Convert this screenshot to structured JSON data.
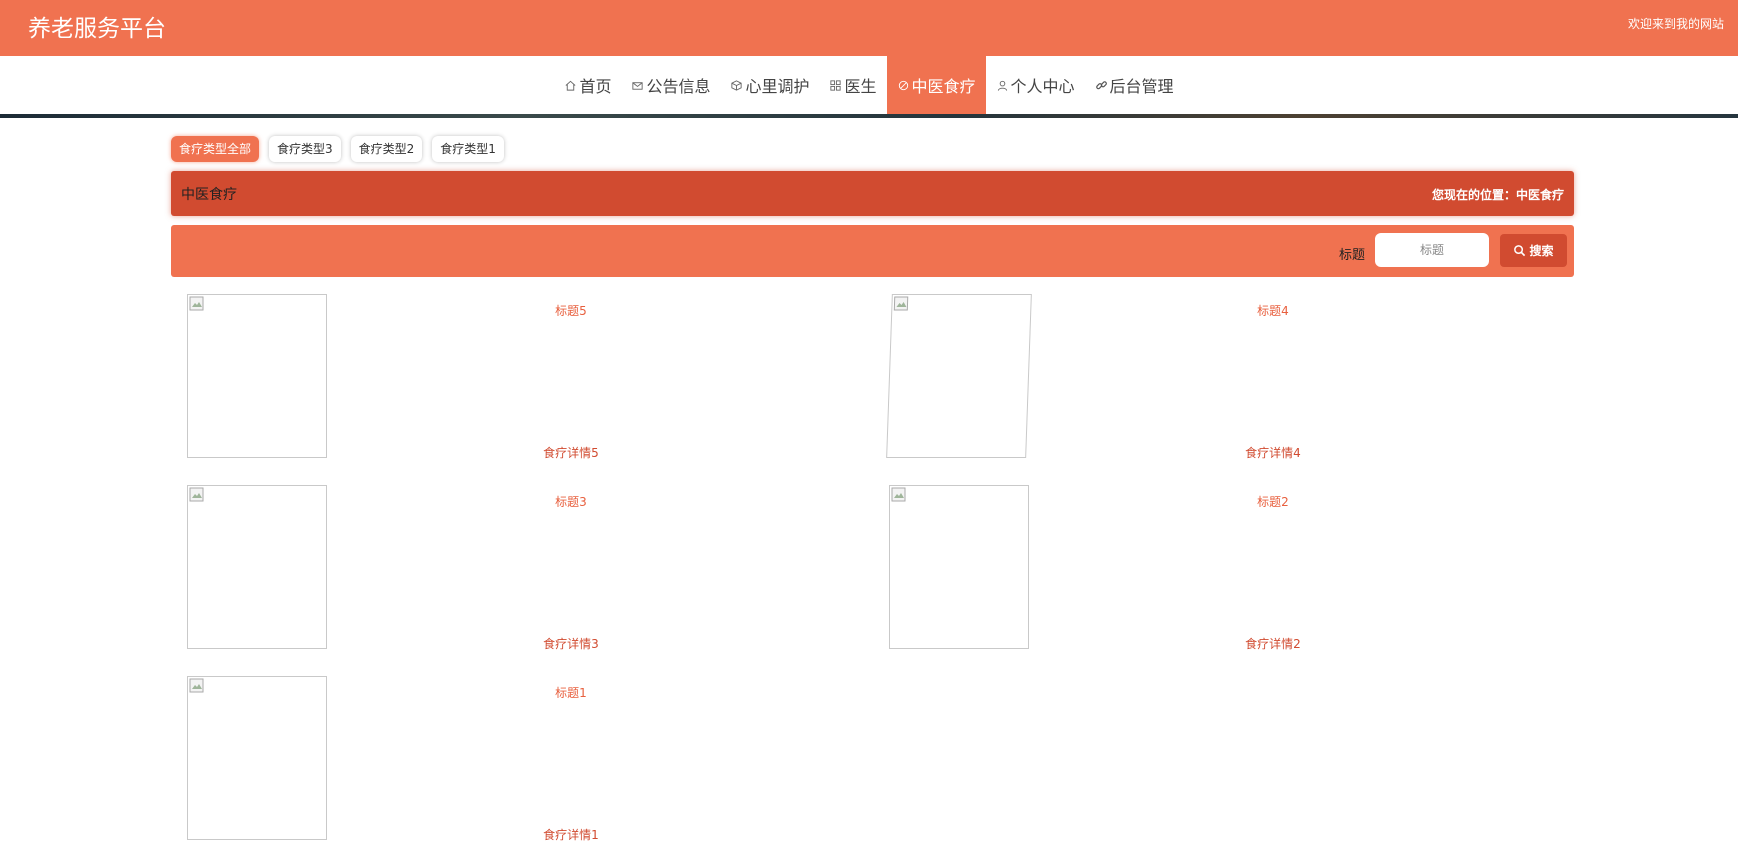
{
  "header": {
    "site_title": "养老服务平台",
    "welcome": "欢迎来到我的网站"
  },
  "nav": {
    "items": [
      {
        "label": "首页",
        "icon": "home-icon"
      },
      {
        "label": "公告信息",
        "icon": "mail-icon"
      },
      {
        "label": "心里调护",
        "icon": "cube-icon"
      },
      {
        "label": "医生",
        "icon": "grid-icon"
      },
      {
        "label": "中医食疗",
        "icon": "medicine-icon",
        "active": true
      },
      {
        "label": "个人中心",
        "icon": "user-icon"
      },
      {
        "label": "后台管理",
        "icon": "link-icon"
      }
    ]
  },
  "filters": {
    "items": [
      "食疗类型全部",
      "食疗类型3",
      "食疗类型2",
      "食疗类型1"
    ],
    "active_index": 0
  },
  "section": {
    "title": "中医食疗",
    "location": "您现在的位置：中医食疗"
  },
  "search": {
    "label": "标题",
    "placeholder": "标题",
    "button_label": "搜索"
  },
  "items": [
    {
      "title": "标题5",
      "detail": "食疗详情5"
    },
    {
      "title": "标题4",
      "detail": "食疗详情4"
    },
    {
      "title": "标题3",
      "detail": "食疗详情3"
    },
    {
      "title": "标题2",
      "detail": "食疗详情2"
    },
    {
      "title": "标题1",
      "detail": "食疗详情1"
    }
  ],
  "colors": {
    "primary": "#f07250",
    "dark": "#d14b30"
  }
}
